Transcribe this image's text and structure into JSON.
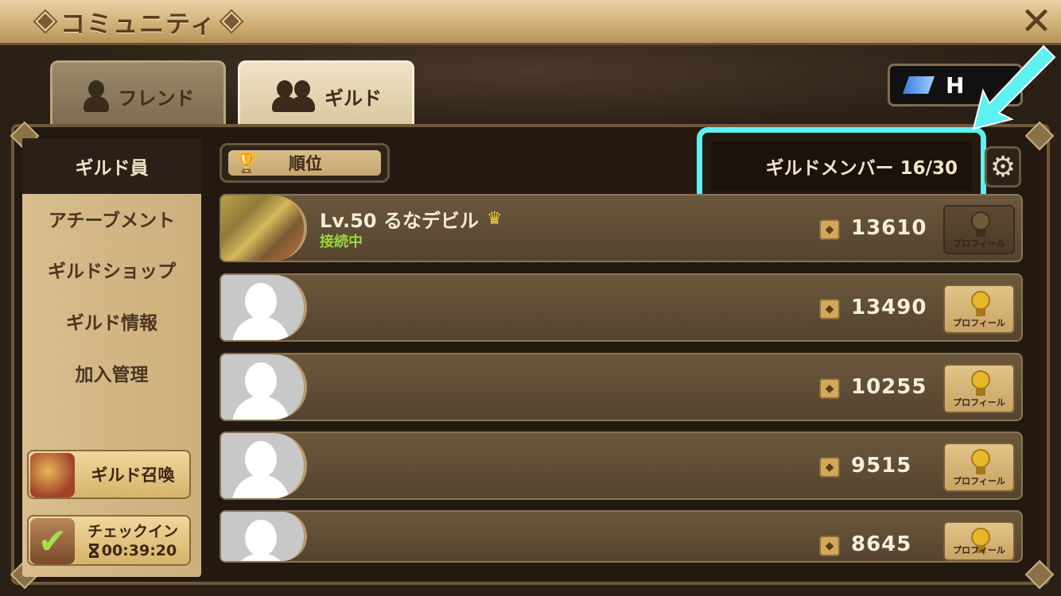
{
  "window": {
    "title": "コミュニティ",
    "close_icon": "close-icon"
  },
  "tabs": [
    {
      "label": "フレンド",
      "icon": "friend-icon",
      "active": false
    },
    {
      "label": "ギルド",
      "icon": "guild-icon",
      "active": true
    }
  ],
  "top_right_button": {
    "label": "H",
    "icon": "crystal-icon"
  },
  "sidebar": {
    "active": "ギルド員",
    "items": [
      "アチーブメント",
      "ギルドショップ",
      "ギルド情報",
      "加入管理"
    ],
    "summon_button": "ギルド召喚",
    "checkin_button": "チェックイン",
    "checkin_timer": "00:39:20"
  },
  "toolbar": {
    "rank_label": "順位",
    "member_count_label": "ギルドメンバー 16/30",
    "settings_icon": "gear-icon"
  },
  "members": [
    {
      "name": "Lv.50 るなデビル",
      "status": "接続中",
      "points": "13610",
      "profile_label": "プロフィール",
      "has_avatar": true,
      "crown": true
    },
    {
      "name": "",
      "status": "",
      "points": "13490",
      "profile_label": "プロフィール",
      "has_avatar": false
    },
    {
      "name": "",
      "status": "",
      "points": "10255",
      "profile_label": "プロフィール",
      "has_avatar": false
    },
    {
      "name": "",
      "status": "",
      "points": "9515",
      "profile_label": "プロフィール",
      "has_avatar": false
    },
    {
      "name": "",
      "status": "",
      "points": "8645",
      "profile_label": "プロフィール",
      "has_avatar": false
    }
  ],
  "colors": {
    "highlight": "#5ff0f0",
    "online": "#9ad540"
  }
}
